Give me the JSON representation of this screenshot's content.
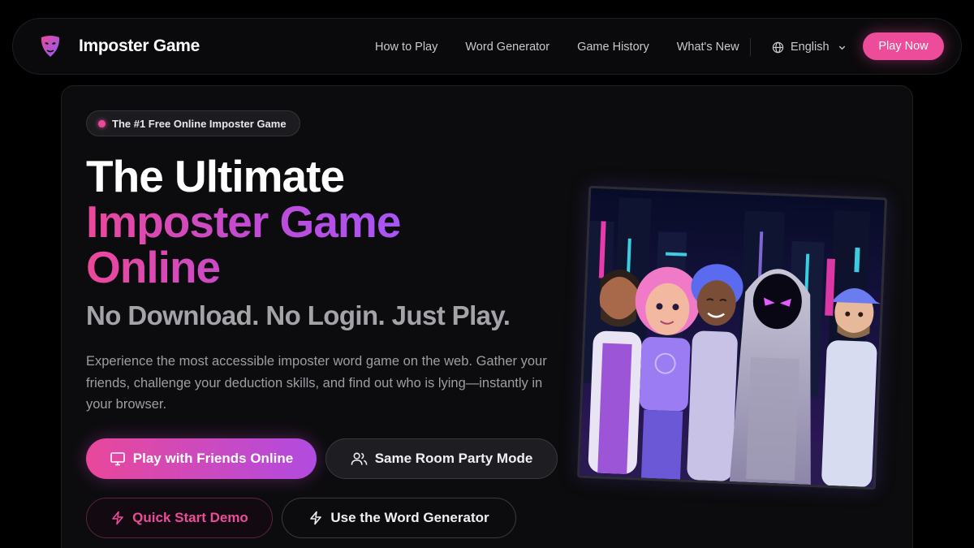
{
  "nav": {
    "brand": "Imposter Game",
    "links": [
      "How to Play",
      "Word Generator",
      "Game History",
      "What's New"
    ],
    "language": "English",
    "cta": "Play Now"
  },
  "hero": {
    "badge": "The #1 Free Online Imposter Game",
    "title_line1": "The Ultimate",
    "title_line2": "Imposter Game",
    "title_line3": "Online",
    "subtitle": "No Download. No Login. Just Play.",
    "description": "Experience the most accessible imposter word game on the web. Gather your friends, challenge your deduction skills, and find out who is lying—instantly in your browser.",
    "buttons": {
      "play_friends": "Play with Friends Online",
      "same_room": "Same Room Party Mode",
      "quick_demo": "Quick Start Demo",
      "word_generator": "Use the Word Generator"
    }
  },
  "icons": {
    "logo": "mask-logo-icon",
    "language": "globe-icon",
    "dropdown": "chevron-down-icon",
    "play_friends": "monitor-icon",
    "same_room": "users-icon",
    "quick_demo": "lightning-icon",
    "word_generator": "lightning-icon"
  },
  "colors": {
    "accent_pink": "#ec4899",
    "accent_purple": "#a855f7",
    "background": "#000000",
    "card": "#0c0c0e"
  }
}
